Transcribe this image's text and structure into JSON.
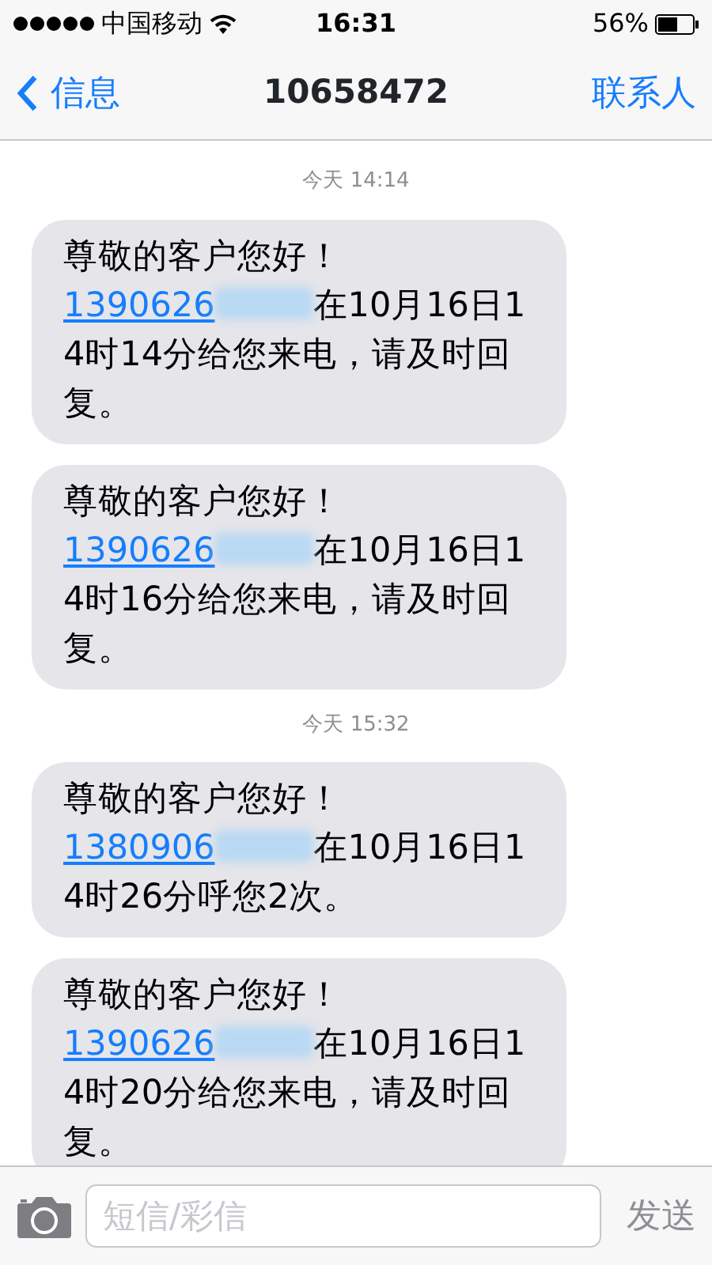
{
  "status_bar": {
    "carrier": "中国移动",
    "time": "16:31",
    "battery": "56%"
  },
  "nav": {
    "back": "信息",
    "title": "10658472",
    "action": "联系人"
  },
  "thread": [
    {
      "kind": "time",
      "text": "今天 14:14"
    },
    {
      "kind": "message",
      "greeting": "尊敬的客户您好！",
      "number": "1390626",
      "rest": "在10月16日14时14分给您来电，请及时回复。"
    },
    {
      "kind": "message",
      "greeting": "尊敬的客户您好！",
      "number": "1390626",
      "rest": "在10月16日14时16分给您来电，请及时回复。"
    },
    {
      "kind": "time",
      "text": "今天 15:32"
    },
    {
      "kind": "message",
      "greeting": "尊敬的客户您好！",
      "number": "1380906",
      "rest": "在10月16日14时26分呼您2次。"
    },
    {
      "kind": "message",
      "greeting": "尊敬的客户您好！",
      "number": "1390626",
      "rest": "在10月16日14时20分给您来电，请及时回复。"
    }
  ],
  "composer": {
    "placeholder": "短信/彩信",
    "send": "发送"
  }
}
